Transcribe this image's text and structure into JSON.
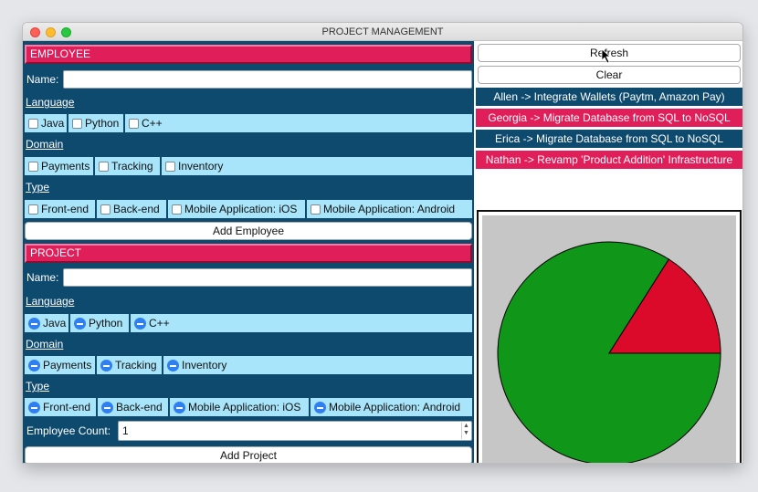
{
  "window": {
    "title": "PROJECT MANAGEMENT"
  },
  "employee": {
    "header": "EMPLOYEE",
    "name_label": "Name:",
    "name_value": "",
    "language_label": "Language",
    "languages": [
      "Java",
      "Python",
      "C++"
    ],
    "domain_label": "Domain",
    "domains": [
      "Payments",
      "Tracking",
      "Inventory"
    ],
    "type_label": "Type",
    "types": [
      "Front-end",
      "Back-end",
      "Mobile Application: iOS",
      "Mobile Application: Android"
    ],
    "add_button": "Add Employee"
  },
  "project": {
    "header": "PROJECT",
    "name_label": "Name:",
    "name_value": "",
    "language_label": "Language",
    "languages": [
      "Java",
      "Python",
      "C++"
    ],
    "domain_label": "Domain",
    "domains": [
      "Payments",
      "Tracking",
      "Inventory"
    ],
    "type_label": "Type",
    "types": [
      "Front-end",
      "Back-end",
      "Mobile Application: iOS",
      "Mobile Application: Android"
    ],
    "count_label": "Employee Count:",
    "count_value": "1",
    "add_button": "Add Project"
  },
  "actions": {
    "refresh": "Refresh",
    "clear": "Clear"
  },
  "assignments": [
    {
      "text": "Allen -> Integrate Wallets (Paytm, Amazon Pay)",
      "color": "#0e4a6e"
    },
    {
      "text": "Georgia -> Migrate Database from SQL to NoSQL",
      "color": "#e01e5a"
    },
    {
      "text": "Erica -> Migrate Database from SQL to NoSQL",
      "color": "#0e4a6e"
    },
    {
      "text": "Nathan -> Revamp 'Product Addition' Infrastructure",
      "color": "#e01e5a"
    }
  ],
  "chart_data": {
    "type": "pie",
    "values": [
      84,
      16
    ],
    "colors": [
      "#109618",
      "#dc0a2a"
    ],
    "start_angle_deg": 0
  },
  "colors": {
    "primary_dark": "#0e4a6e",
    "accent": "#e01e5a",
    "chip": "#a8e4fa",
    "selected_icon": "#2f7ff0"
  }
}
